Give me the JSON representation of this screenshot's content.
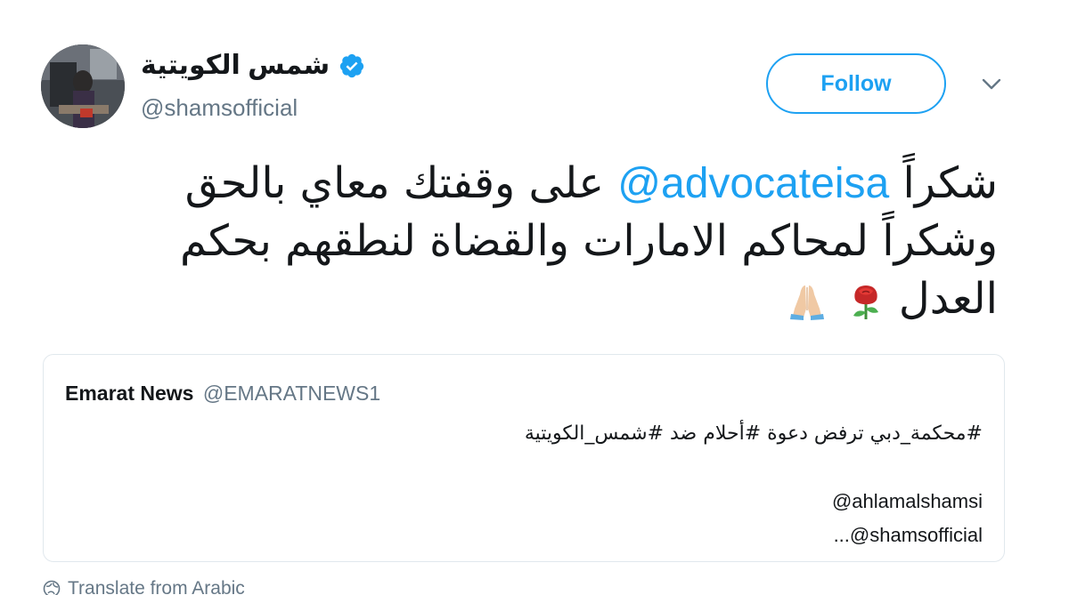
{
  "author": {
    "display_name": "شمس الكويتية",
    "handle": "@shamsofficial",
    "verified": true
  },
  "actions": {
    "follow_label": "Follow"
  },
  "tweet": {
    "line1_text": "شكراً",
    "line1_mention": "@advocateisa",
    "line1_rest": "على وقفتك معاي بالحق",
    "line2": "وشكراً لمحاكم الامارات والقضاة لنطقهم بحكم",
    "line3": "العدل",
    "emojis": [
      "rose-emoji",
      "folded-hands-emoji"
    ]
  },
  "quote": {
    "name": "Emarat News",
    "handle": "@EMARATNEWS1",
    "hashtags_line": "#محكمة_دبي ترفض دعوة #أحلام ضد #شمس_الكويتية",
    "mention_1": "@ahlamalshamsi",
    "mention_2": "...@shamsofficial"
  },
  "translate": {
    "label": "Translate from Arabic"
  },
  "colors": {
    "brand_blue": "#1da1f2",
    "text_primary": "#14171a",
    "text_secondary": "#657786",
    "border": "#e1e8ed"
  }
}
